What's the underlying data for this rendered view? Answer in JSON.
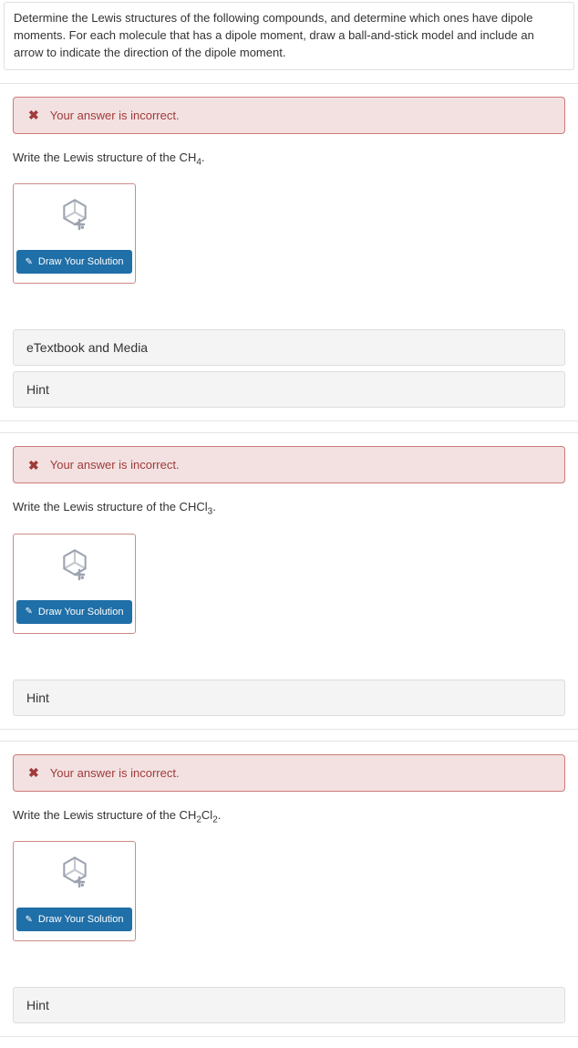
{
  "intro": "Determine the Lewis structures of the following compounds, and determine which ones have dipole moments. For each molecule that has a dipole moment, draw a ball-and-stick model and include an arrow to indicate the direction of the dipole moment.",
  "alert_text": "Your answer is incorrect.",
  "draw_button_label": "Draw Your Solution",
  "etextbook_label": "eTextbook and Media",
  "hint_label": "Hint",
  "q1": {
    "prompt_prefix": "Write the Lewis structure of the CH",
    "prompt_sub": "4",
    "prompt_suffix": "."
  },
  "q2": {
    "prompt_prefix": "Write the Lewis structure of the CHCl",
    "prompt_sub": "3",
    "prompt_suffix": "."
  },
  "q3": {
    "prompt_prefix": "Write the Lewis structure of the CH",
    "prompt_sub1": "2",
    "prompt_mid": "Cl",
    "prompt_sub2": "2",
    "prompt_suffix": "."
  }
}
